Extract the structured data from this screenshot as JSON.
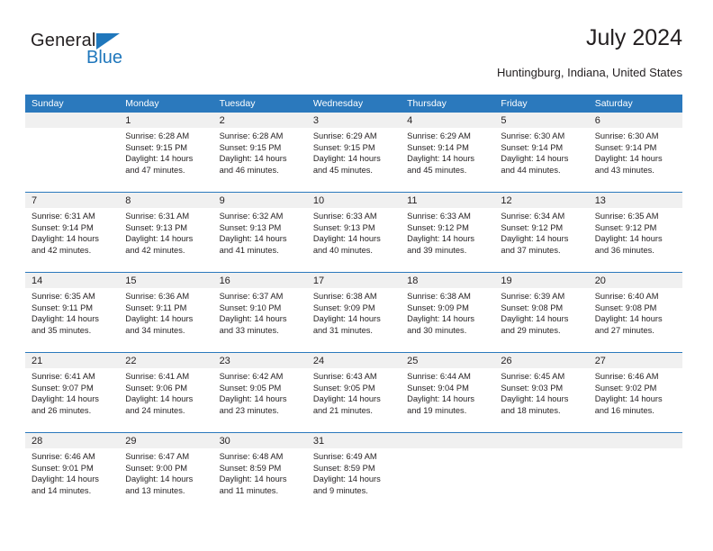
{
  "brand": {
    "name_top": "General",
    "name_bottom": "Blue"
  },
  "header": {
    "title": "July 2024",
    "location": "Huntingburg, Indiana, United States"
  },
  "theme": {
    "header_blue": "#2b79bd",
    "date_band_gray": "#f0f0f0",
    "text": "#231f20",
    "logo_blue": "#1f77bc"
  },
  "weekdays": [
    "Sunday",
    "Monday",
    "Tuesday",
    "Wednesday",
    "Thursday",
    "Friday",
    "Saturday"
  ],
  "weeks": [
    [
      {
        "date": "",
        "sunrise": "",
        "sunset": "",
        "daylight1": "",
        "daylight2": ""
      },
      {
        "date": "1",
        "sunrise": "Sunrise: 6:28 AM",
        "sunset": "Sunset: 9:15 PM",
        "daylight1": "Daylight: 14 hours",
        "daylight2": "and 47 minutes."
      },
      {
        "date": "2",
        "sunrise": "Sunrise: 6:28 AM",
        "sunset": "Sunset: 9:15 PM",
        "daylight1": "Daylight: 14 hours",
        "daylight2": "and 46 minutes."
      },
      {
        "date": "3",
        "sunrise": "Sunrise: 6:29 AM",
        "sunset": "Sunset: 9:15 PM",
        "daylight1": "Daylight: 14 hours",
        "daylight2": "and 45 minutes."
      },
      {
        "date": "4",
        "sunrise": "Sunrise: 6:29 AM",
        "sunset": "Sunset: 9:14 PM",
        "daylight1": "Daylight: 14 hours",
        "daylight2": "and 45 minutes."
      },
      {
        "date": "5",
        "sunrise": "Sunrise: 6:30 AM",
        "sunset": "Sunset: 9:14 PM",
        "daylight1": "Daylight: 14 hours",
        "daylight2": "and 44 minutes."
      },
      {
        "date": "6",
        "sunrise": "Sunrise: 6:30 AM",
        "sunset": "Sunset: 9:14 PM",
        "daylight1": "Daylight: 14 hours",
        "daylight2": "and 43 minutes."
      }
    ],
    [
      {
        "date": "7",
        "sunrise": "Sunrise: 6:31 AM",
        "sunset": "Sunset: 9:14 PM",
        "daylight1": "Daylight: 14 hours",
        "daylight2": "and 42 minutes."
      },
      {
        "date": "8",
        "sunrise": "Sunrise: 6:31 AM",
        "sunset": "Sunset: 9:13 PM",
        "daylight1": "Daylight: 14 hours",
        "daylight2": "and 42 minutes."
      },
      {
        "date": "9",
        "sunrise": "Sunrise: 6:32 AM",
        "sunset": "Sunset: 9:13 PM",
        "daylight1": "Daylight: 14 hours",
        "daylight2": "and 41 minutes."
      },
      {
        "date": "10",
        "sunrise": "Sunrise: 6:33 AM",
        "sunset": "Sunset: 9:13 PM",
        "daylight1": "Daylight: 14 hours",
        "daylight2": "and 40 minutes."
      },
      {
        "date": "11",
        "sunrise": "Sunrise: 6:33 AM",
        "sunset": "Sunset: 9:12 PM",
        "daylight1": "Daylight: 14 hours",
        "daylight2": "and 39 minutes."
      },
      {
        "date": "12",
        "sunrise": "Sunrise: 6:34 AM",
        "sunset": "Sunset: 9:12 PM",
        "daylight1": "Daylight: 14 hours",
        "daylight2": "and 37 minutes."
      },
      {
        "date": "13",
        "sunrise": "Sunrise: 6:35 AM",
        "sunset": "Sunset: 9:12 PM",
        "daylight1": "Daylight: 14 hours",
        "daylight2": "and 36 minutes."
      }
    ],
    [
      {
        "date": "14",
        "sunrise": "Sunrise: 6:35 AM",
        "sunset": "Sunset: 9:11 PM",
        "daylight1": "Daylight: 14 hours",
        "daylight2": "and 35 minutes."
      },
      {
        "date": "15",
        "sunrise": "Sunrise: 6:36 AM",
        "sunset": "Sunset: 9:11 PM",
        "daylight1": "Daylight: 14 hours",
        "daylight2": "and 34 minutes."
      },
      {
        "date": "16",
        "sunrise": "Sunrise: 6:37 AM",
        "sunset": "Sunset: 9:10 PM",
        "daylight1": "Daylight: 14 hours",
        "daylight2": "and 33 minutes."
      },
      {
        "date": "17",
        "sunrise": "Sunrise: 6:38 AM",
        "sunset": "Sunset: 9:09 PM",
        "daylight1": "Daylight: 14 hours",
        "daylight2": "and 31 minutes."
      },
      {
        "date": "18",
        "sunrise": "Sunrise: 6:38 AM",
        "sunset": "Sunset: 9:09 PM",
        "daylight1": "Daylight: 14 hours",
        "daylight2": "and 30 minutes."
      },
      {
        "date": "19",
        "sunrise": "Sunrise: 6:39 AM",
        "sunset": "Sunset: 9:08 PM",
        "daylight1": "Daylight: 14 hours",
        "daylight2": "and 29 minutes."
      },
      {
        "date": "20",
        "sunrise": "Sunrise: 6:40 AM",
        "sunset": "Sunset: 9:08 PM",
        "daylight1": "Daylight: 14 hours",
        "daylight2": "and 27 minutes."
      }
    ],
    [
      {
        "date": "21",
        "sunrise": "Sunrise: 6:41 AM",
        "sunset": "Sunset: 9:07 PM",
        "daylight1": "Daylight: 14 hours",
        "daylight2": "and 26 minutes."
      },
      {
        "date": "22",
        "sunrise": "Sunrise: 6:41 AM",
        "sunset": "Sunset: 9:06 PM",
        "daylight1": "Daylight: 14 hours",
        "daylight2": "and 24 minutes."
      },
      {
        "date": "23",
        "sunrise": "Sunrise: 6:42 AM",
        "sunset": "Sunset: 9:05 PM",
        "daylight1": "Daylight: 14 hours",
        "daylight2": "and 23 minutes."
      },
      {
        "date": "24",
        "sunrise": "Sunrise: 6:43 AM",
        "sunset": "Sunset: 9:05 PM",
        "daylight1": "Daylight: 14 hours",
        "daylight2": "and 21 minutes."
      },
      {
        "date": "25",
        "sunrise": "Sunrise: 6:44 AM",
        "sunset": "Sunset: 9:04 PM",
        "daylight1": "Daylight: 14 hours",
        "daylight2": "and 19 minutes."
      },
      {
        "date": "26",
        "sunrise": "Sunrise: 6:45 AM",
        "sunset": "Sunset: 9:03 PM",
        "daylight1": "Daylight: 14 hours",
        "daylight2": "and 18 minutes."
      },
      {
        "date": "27",
        "sunrise": "Sunrise: 6:46 AM",
        "sunset": "Sunset: 9:02 PM",
        "daylight1": "Daylight: 14 hours",
        "daylight2": "and 16 minutes."
      }
    ],
    [
      {
        "date": "28",
        "sunrise": "Sunrise: 6:46 AM",
        "sunset": "Sunset: 9:01 PM",
        "daylight1": "Daylight: 14 hours",
        "daylight2": "and 14 minutes."
      },
      {
        "date": "29",
        "sunrise": "Sunrise: 6:47 AM",
        "sunset": "Sunset: 9:00 PM",
        "daylight1": "Daylight: 14 hours",
        "daylight2": "and 13 minutes."
      },
      {
        "date": "30",
        "sunrise": "Sunrise: 6:48 AM",
        "sunset": "Sunset: 8:59 PM",
        "daylight1": "Daylight: 14 hours",
        "daylight2": "and 11 minutes."
      },
      {
        "date": "31",
        "sunrise": "Sunrise: 6:49 AM",
        "sunset": "Sunset: 8:59 PM",
        "daylight1": "Daylight: 14 hours",
        "daylight2": "and 9 minutes."
      },
      {
        "date": "",
        "sunrise": "",
        "sunset": "",
        "daylight1": "",
        "daylight2": ""
      },
      {
        "date": "",
        "sunrise": "",
        "sunset": "",
        "daylight1": "",
        "daylight2": ""
      },
      {
        "date": "",
        "sunrise": "",
        "sunset": "",
        "daylight1": "",
        "daylight2": ""
      }
    ]
  ]
}
